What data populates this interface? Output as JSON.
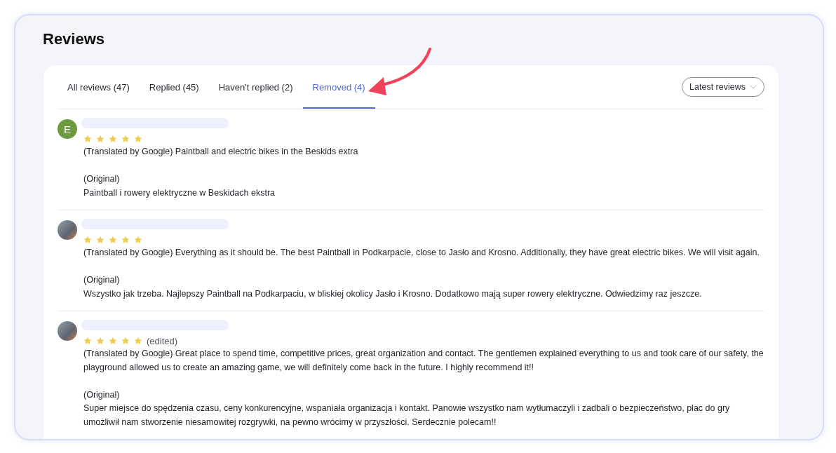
{
  "title": "Reviews",
  "tabs": [
    {
      "label": "All reviews (47)",
      "selected": false
    },
    {
      "label": "Replied (45)",
      "selected": false
    },
    {
      "label": "Haven't replied (2)",
      "selected": false
    },
    {
      "label": "Removed (4)",
      "selected": true
    }
  ],
  "sort": {
    "label": "Latest reviews"
  },
  "reviews": [
    {
      "avatar": {
        "kind": "letter",
        "letter": "E"
      },
      "stars": 5,
      "translated": "(Translated by Google) Paintball and electric bikes in the Beskids extra",
      "original_label": "(Original)",
      "original": "Paintball i rowery elektryczne w Beskidach ekstra"
    },
    {
      "avatar": {
        "kind": "photo"
      },
      "stars": 5,
      "translated": "(Translated by Google) Everything as it should be. The best Paintball in Podkarpacie, close to Jasło and Krosno. Additionally, they have great electric bikes. We will visit again.",
      "original_label": "(Original)",
      "original": "Wszystko jak trzeba. Najlepszy Paintball na Podkarpaciu, w bliskiej okolicy Jasło i Krosno. Dodatkowo mają super rowery elektryczne. Odwiedzimy raz jeszcze."
    },
    {
      "avatar": {
        "kind": "photo"
      },
      "stars": 5,
      "edited_label": "(edited)",
      "translated": "(Translated by Google) Great place to spend time, competitive prices, great organization and contact. The gentlemen explained everything to us and took care of our safety, the playground allowed us to create an amazing game, we will definitely come back in the future. I highly recommend it!!",
      "original_label": "(Original)",
      "original": "Super miejsce do spędzenia czasu, ceny konkurencyjne, wspaniała organizacja i kontakt. Panowie wszystko nam wytłumaczyli i zadbali o bezpieczeństwo, plac do gry umożliwił nam stworzenie niesamowitej rozgrywki, na pewno wrócimy w przyszłości. Serdecznie polecam!!"
    }
  ]
}
